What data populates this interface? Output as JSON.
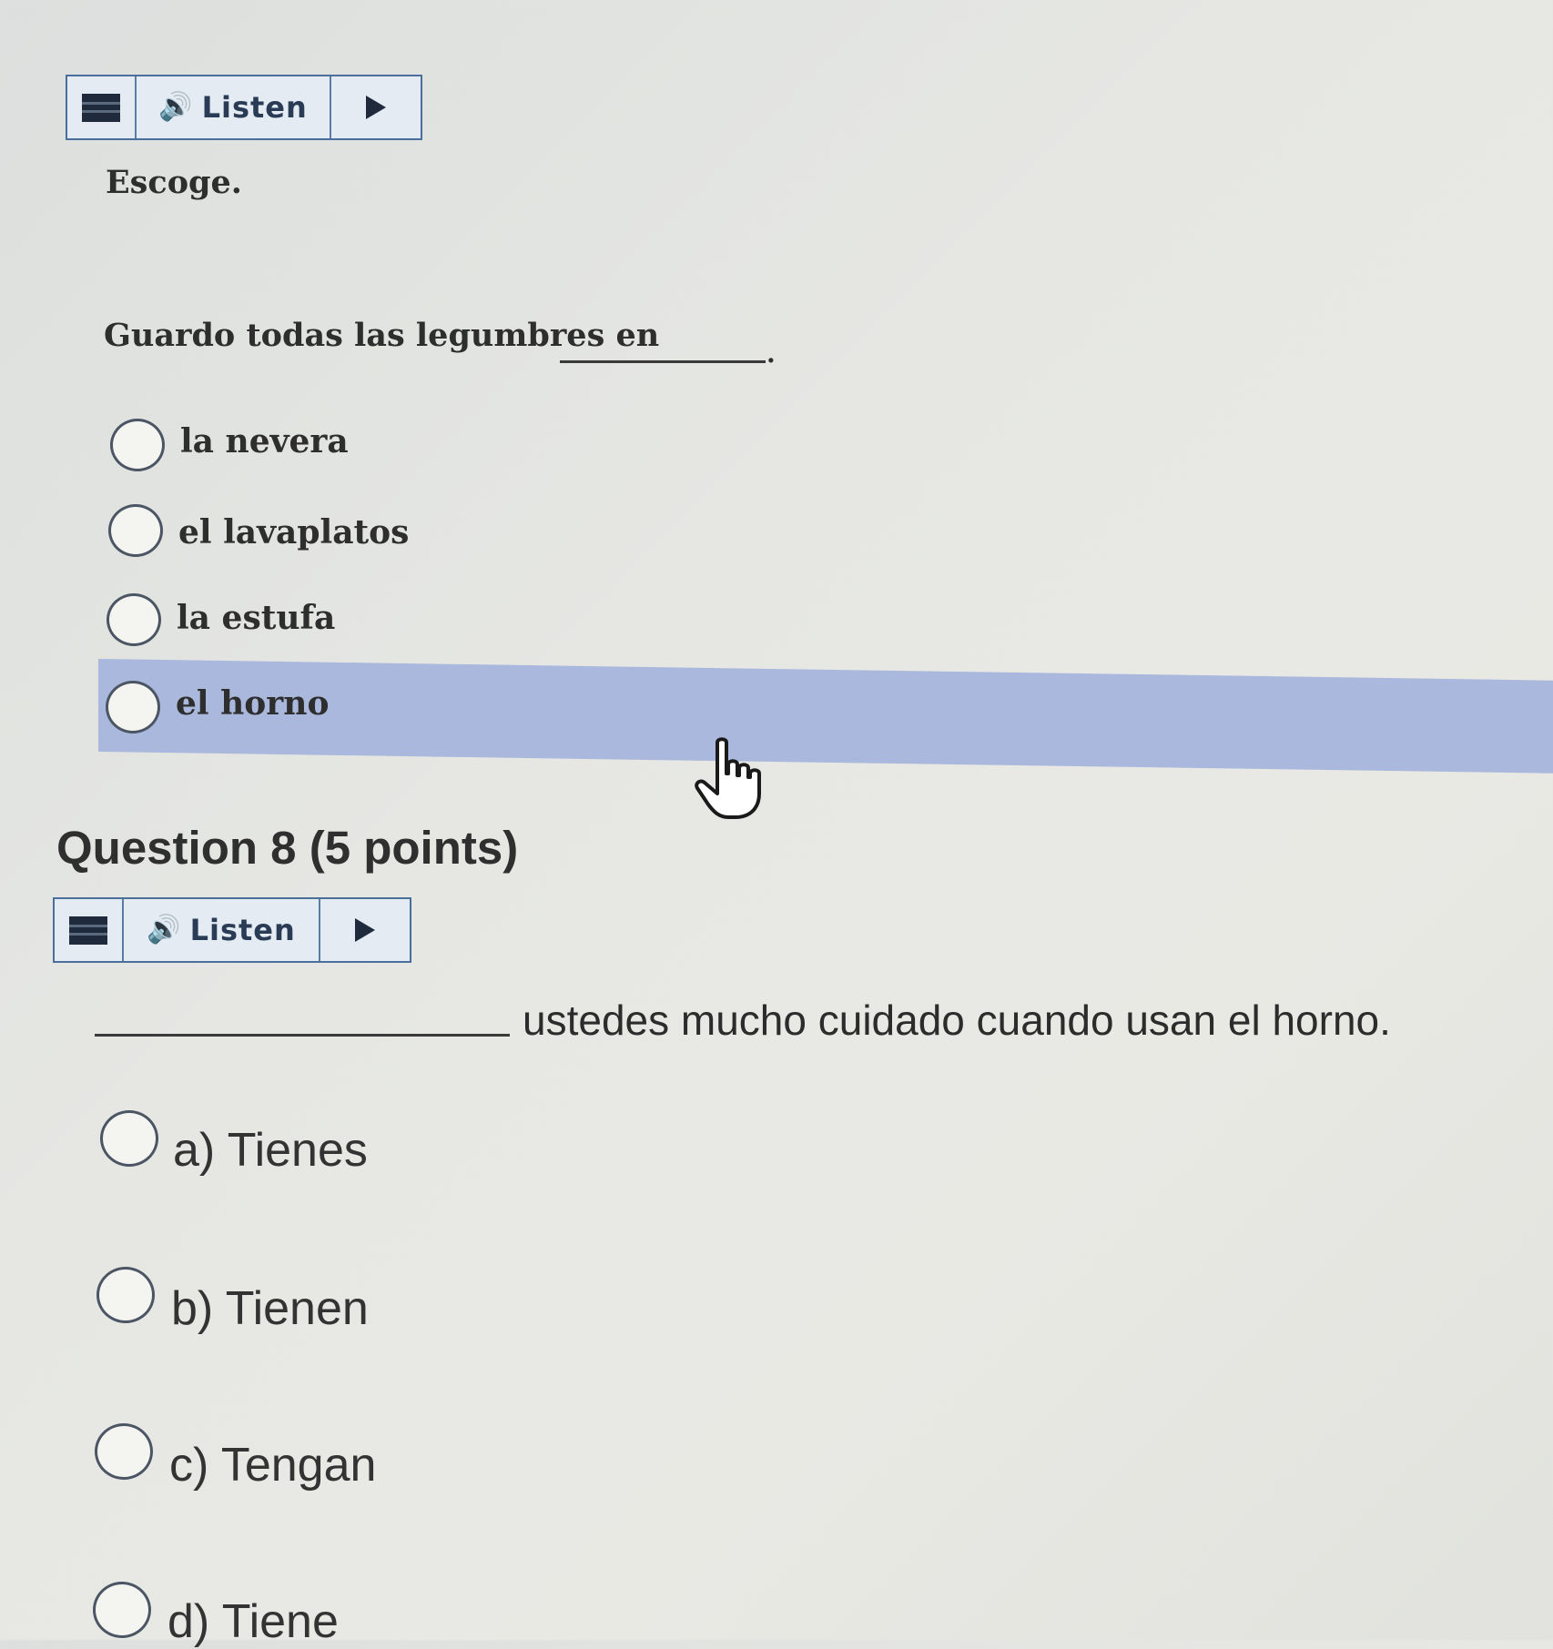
{
  "q7": {
    "listen_bar": {
      "listen_label": "Listen"
    },
    "instruction": "Escoge.",
    "prompt": "Guardo todas las legumbres en",
    "prompt_end": ".",
    "options": [
      {
        "label": "la nevera"
      },
      {
        "label": "el lavaplatos"
      },
      {
        "label": "la estufa"
      },
      {
        "label": "el horno",
        "hovered": true
      }
    ]
  },
  "q8": {
    "title": "Question 8 (5 points)",
    "listen_bar": {
      "listen_label": "Listen"
    },
    "sentence": "ustedes mucho cuidado cuando usan el horno.",
    "options": [
      {
        "label": "a) Tienes"
      },
      {
        "label": "b) Tienen"
      },
      {
        "label": "c) Tengan"
      },
      {
        "label": "d) Tiene"
      }
    ]
  },
  "icons": {
    "menu": "menu-icon",
    "speaker": "speaker-icon",
    "play": "play-icon",
    "cursor": "hand-pointer-cursor-icon"
  },
  "colors": {
    "highlight": "#a9b8dc",
    "toolbar_border": "#4a6f9c"
  }
}
